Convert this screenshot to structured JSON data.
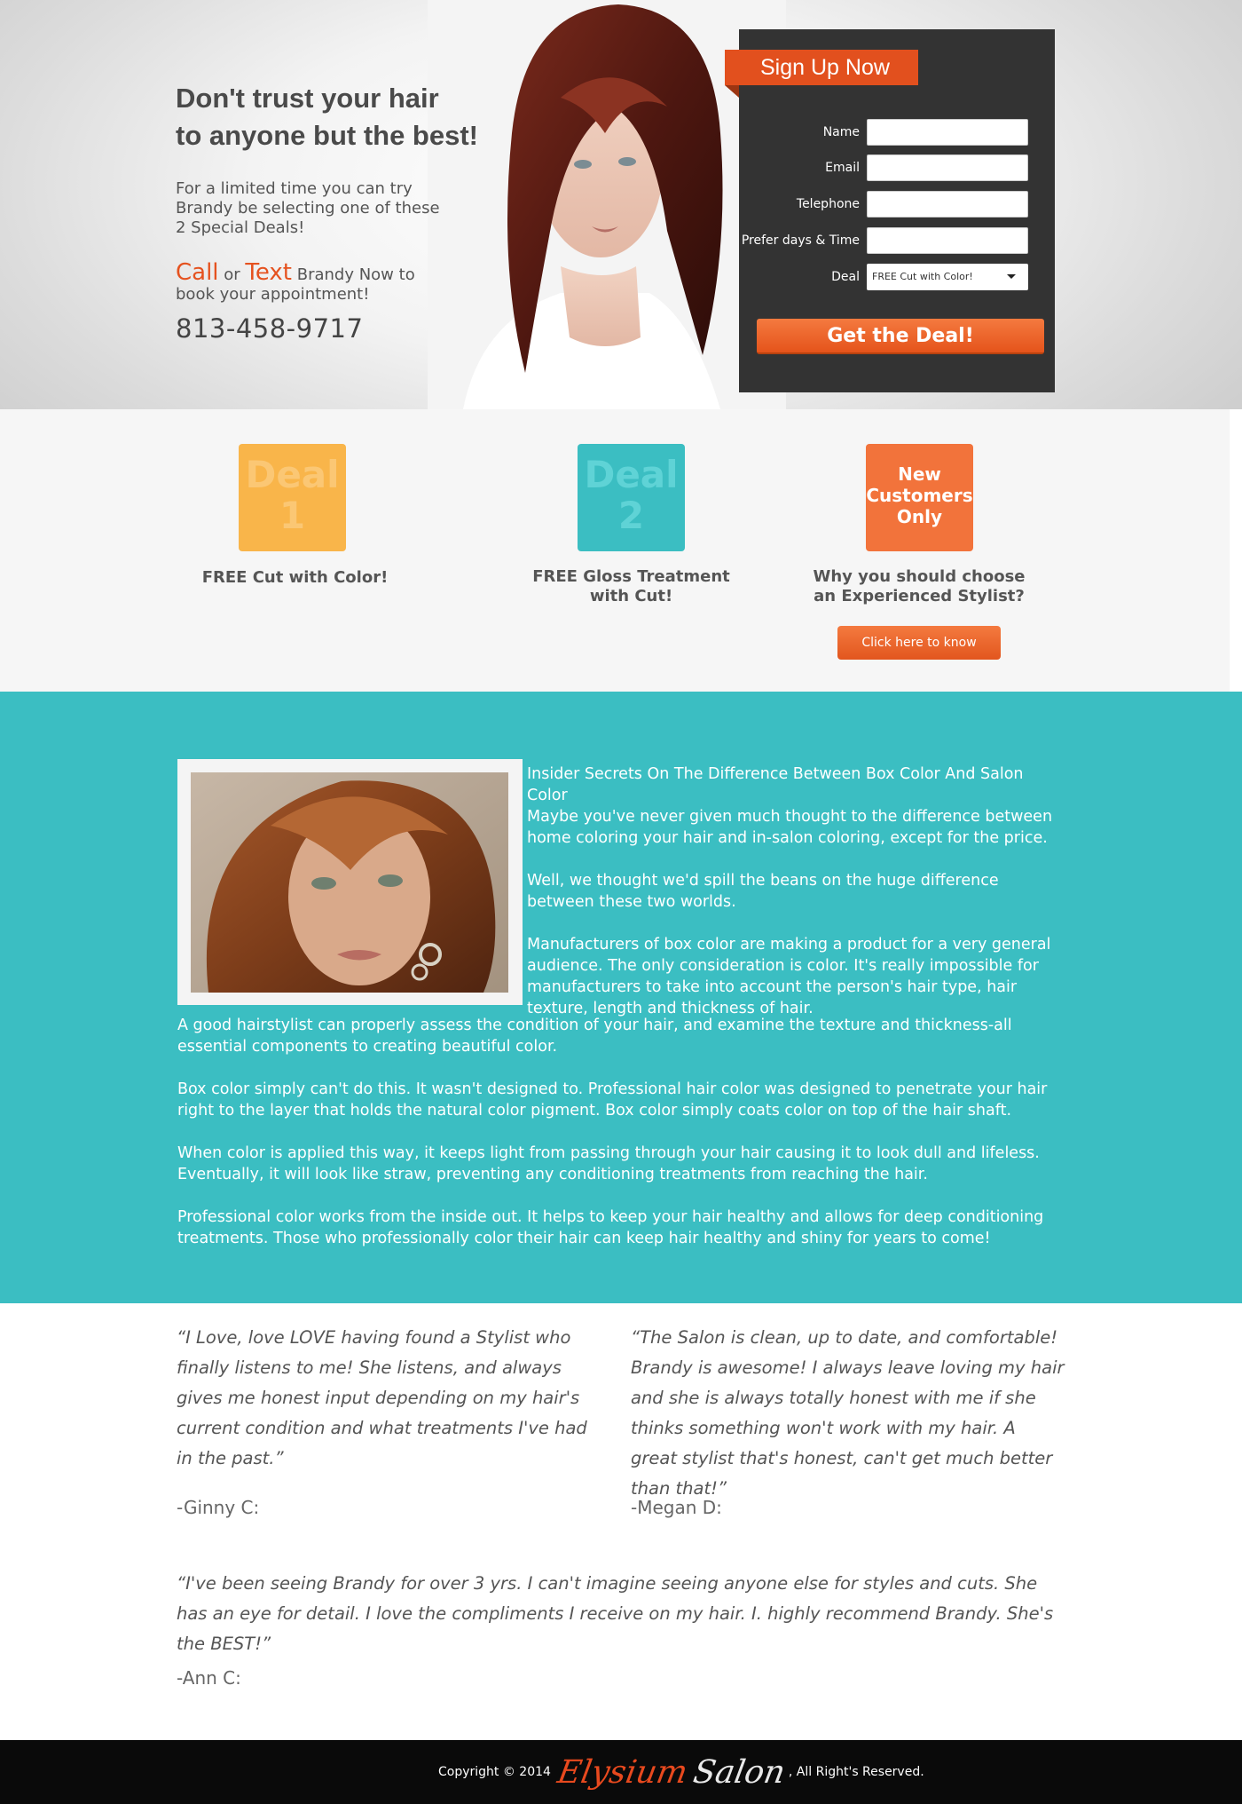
{
  "hero": {
    "title_line1": "Don't trust your hair",
    "title_line2": "to anyone but the best!",
    "intro": "For a limited time you can try Brandy be selecting one of these 2 Special Deals!",
    "cta_call": "Call",
    "cta_or": " or ",
    "cta_text": "Text",
    "cta_rest": " Brandy Now to book your appointment!",
    "phone": "813-458-9717"
  },
  "signup": {
    "title": "Sign Up Now",
    "fields": [
      {
        "label": "Name",
        "value": ""
      },
      {
        "label": "Email",
        "value": ""
      },
      {
        "label": "Telephone",
        "value": ""
      },
      {
        "label": "Prefer days & Time",
        "value": ""
      }
    ],
    "deal_label": "Deal",
    "deal_selected": "FREE Cut with Color!",
    "submit_label": "Get the Deal!"
  },
  "deals": [
    {
      "badge_line1": "Deal",
      "badge_line2": "1",
      "caption": "FREE Cut with Color!",
      "color": "#f9b54a",
      "text_color": "#fbc774"
    },
    {
      "badge_line1": "Deal",
      "badge_line2": "2",
      "caption_line1": "FREE Gloss Treatment",
      "caption_line2": "with Cut!",
      "color": "#3bbec2",
      "text_color": "#5fd3d6"
    },
    {
      "badge_line1": "New",
      "badge_line2": "Customers",
      "badge_line3": "Only",
      "caption_line1": "Why you should choose",
      "caption_line2": "an Experienced Stylist?",
      "color": "#f2733b",
      "button_label": "Click here to know"
    }
  ],
  "article": {
    "heading": "Insider Secrets On The Difference Between Box Color And Salon Color",
    "p1": "Maybe you've never given much thought to the difference between home coloring your hair and in-salon coloring, except for the price.",
    "p2": "Well, we thought we'd spill the beans on the huge difference between these two worlds.",
    "p3": "Manufacturers of box color are making a product for a very general audience. The only consideration is color. It's really impossible for manufacturers to take into account the person's hair type, hair texture, length and thickness of hair.",
    "p4": "A good hairstylist can properly assess the condition of your hair, and examine the texture and thickness-all essential components to creating beautiful color.",
    "p5": "Box color simply can't do this. It wasn't designed to. Professional hair color was designed to penetrate your hair right to the layer that holds the natural color pigment. Box color simply coats color on top of the hair shaft.",
    "p6": "When color is applied this way, it keeps light from passing through your hair causing it to look dull and lifeless. Eventually, it will look like straw, preventing any conditioning treatments from reaching the hair.",
    "p7": "Professional color works from the inside out. It helps to keep your hair healthy and allows for deep conditioning treatments. Those who professionally color their hair can keep hair healthy and shiny for years to come!"
  },
  "testimonials": [
    {
      "quote": "“I Love, love LOVE having found a Stylist who finally listens to me! She listens, and always gives me honest input depending on my hair's current condition and what treatments I've had in the past.”",
      "author": "-Ginny C:"
    },
    {
      "quote": "“The Salon is clean, up to date, and comfortable! Brandy is awesome! I always leave loving my hair and she is always totally honest with me if she thinks something won't work with my hair. A great stylist that's honest, can't get much better than that!”",
      "author": "-Megan D:"
    },
    {
      "quote": "“I've been seeing Brandy for over 3 yrs. I can't imagine seeing anyone else for styles and cuts. She has an eye for detail. I love the compliments I receive on my hair. I. highly recommend Brandy. She's the BEST!”",
      "author": "-Ann C:"
    }
  ],
  "footer": {
    "copyright": "Copyright © 2014",
    "logo_word1": "Elysium",
    "logo_word2": "Salon",
    "rights": ", All Right's Reserved."
  },
  "colors": {
    "accent": "#e5521f",
    "teal": "#3bbec2",
    "form_bg": "#333333"
  }
}
